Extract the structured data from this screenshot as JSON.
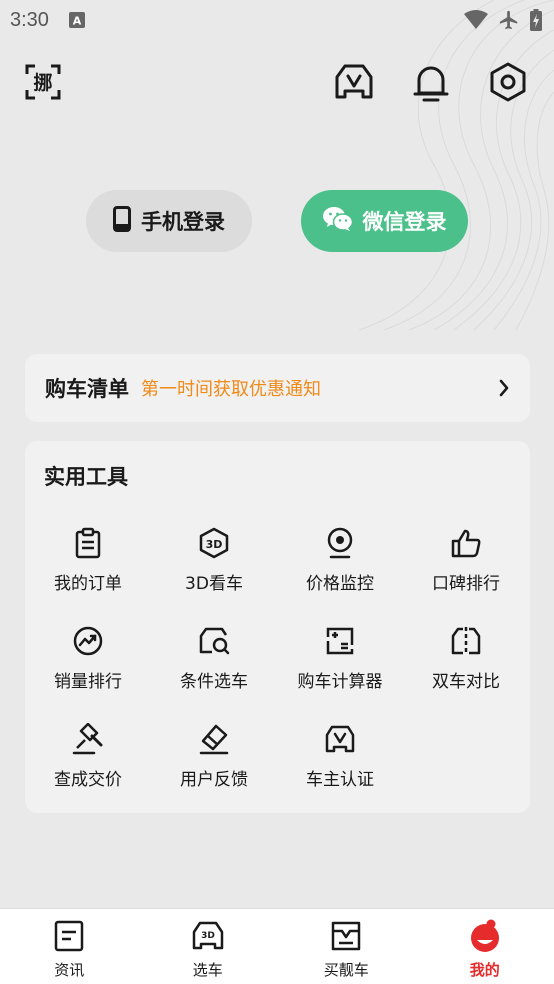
{
  "status_bar": {
    "time": "3:30",
    "notification_icon": "a-badge-icon",
    "icons": [
      "wifi-icon",
      "airplane-icon",
      "battery-charging-icon"
    ]
  },
  "header": {
    "scan_icon": "scan-nuo-icon",
    "scan_glyph": "挪",
    "icons": [
      "garage-icon",
      "bell-icon",
      "settings-icon"
    ]
  },
  "login": {
    "phone_label": "手机登录",
    "wechat_label": "微信登录",
    "wechat_color": "#4cc08a"
  },
  "purchase_list": {
    "title": "购车清单",
    "subtitle": "第一时间获取优惠通知",
    "subtitle_color": "#f08a19"
  },
  "tools": {
    "title": "实用工具",
    "items": [
      {
        "label": "我的订单",
        "icon": "order-clipboard-icon"
      },
      {
        "label": "3D看车",
        "icon": "3d-cube-icon"
      },
      {
        "label": "价格监控",
        "icon": "webcam-icon"
      },
      {
        "label": "口碑排行",
        "icon": "thumbs-up-icon"
      },
      {
        "label": "销量排行",
        "icon": "trend-chart-icon"
      },
      {
        "label": "条件选车",
        "icon": "car-search-icon"
      },
      {
        "label": "购车计算器",
        "icon": "calculator-icon"
      },
      {
        "label": "双车对比",
        "icon": "car-compare-icon"
      },
      {
        "label": "查成交价",
        "icon": "auction-hammer-icon"
      },
      {
        "label": "用户反馈",
        "icon": "eraser-feedback-icon"
      },
      {
        "label": "车主认证",
        "icon": "car-verify-icon"
      }
    ]
  },
  "bottom_nav": {
    "items": [
      {
        "label": "资讯",
        "icon": "news-icon"
      },
      {
        "label": "选车",
        "icon": "car-3d-icon"
      },
      {
        "label": "买靓车",
        "icon": "shopping-box-icon"
      },
      {
        "label": "我的",
        "icon": "profile-mascot-icon",
        "active": true
      }
    ],
    "active_color": "#e52b2b"
  }
}
